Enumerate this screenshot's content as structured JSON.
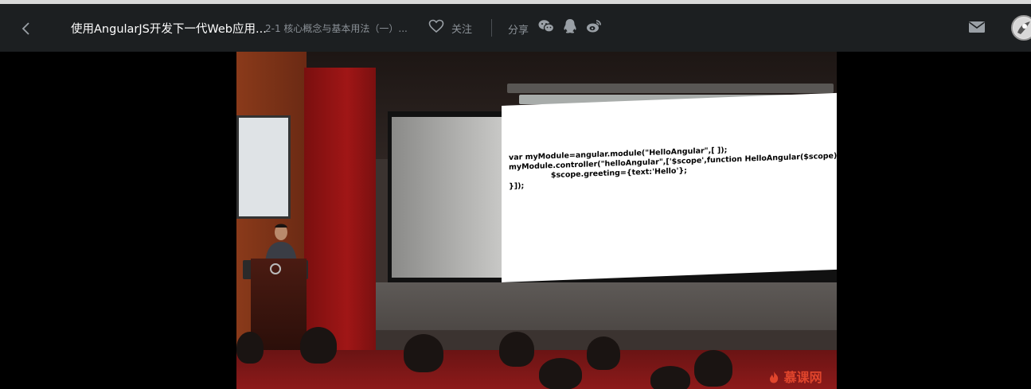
{
  "header": {
    "title": "使用AngularJS开发下一代Web应用...",
    "subtitle": "2-1 核心概念与基本用法（一）...",
    "follow_label": "关注",
    "share_label": "分享"
  },
  "video": {
    "code_lines": [
      "var myModule=angular.module(\"HelloAngular\",[ ]);",
      "myModule.controller(\"helloAngular\",['$scope',function HelloAngular($scope){",
      "                $scope.greeting={text:'Hello'};",
      "}]);"
    ],
    "watermark": "慕课网"
  },
  "icons": {
    "back": "chevron-left-icon",
    "follow": "heart-icon",
    "wechat": "wechat-icon",
    "qq": "qq-icon",
    "weibo": "weibo-icon",
    "mail": "mail-icon",
    "avatar": "avatar"
  },
  "colors": {
    "header_bg": "#1c1f21",
    "text_muted": "#8a9096",
    "watermark": "#e0452c"
  }
}
